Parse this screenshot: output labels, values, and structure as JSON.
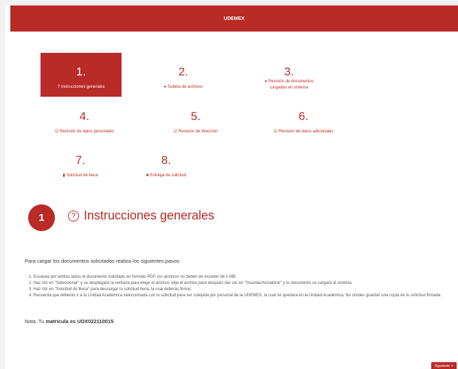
{
  "header": {
    "title": "UDEMEX"
  },
  "steps": [
    {
      "num": "1.",
      "label": "Instrucciones generales",
      "icon": "question-circle-icon"
    },
    {
      "num": "2.",
      "label": "Subida de archivos",
      "icon": "user-upload-icon"
    },
    {
      "num": "3.",
      "label": "Revisión de documentos cargados en sistema",
      "icon": "users-icon"
    },
    {
      "num": "4.",
      "label": "Revisión de datos personales",
      "icon": "checkbox-icon"
    },
    {
      "num": "5.",
      "label": "Revisión de dirección",
      "icon": "checkbox-icon"
    },
    {
      "num": "6.",
      "label": "Revisión de datos adicionales",
      "icon": "checkbox-icon"
    },
    {
      "num": "7.",
      "label": "Solicitud de beca",
      "icon": "file-icon"
    },
    {
      "num": "8.",
      "label": "Entrega de solicitud",
      "icon": "truck-icon"
    }
  ],
  "section": {
    "badge": "1",
    "title": "Instrucciones generales"
  },
  "instructions": {
    "intro": "Para cargar los documentos solicitados realiza los siguientes pasos:",
    "items": [
      "1. Escanea por ambos lados el documento solicitado en formato PDF, los archivos no deben de exceder de 1 MB.",
      "2. Haz clic en \"Seleccionar\" y se desplegará la ventana para elegir el archivo; elije el archivo para después dar clic en \"Guardar/Actualizar\" y tu documento se cargará al sistema.",
      "3. Haz clic en \"Solicitud de Beca\" para descargar tu solicitud llena, la cual deberás firmar.",
      "4. Recuerda que deberás ir a tu Unidad Académica seleccionada con tu solicitud para ser cotejada por personal de la UDEMEX, la cual se quedará en la Unidad Académica. No olvides guardar una copia de tu solicitud firmada."
    ]
  },
  "note": {
    "prefix": "Nota: Tu ",
    "bold": "matrícula es UDX022110015",
    "suffix": "."
  },
  "next_button": "Siguiente >"
}
